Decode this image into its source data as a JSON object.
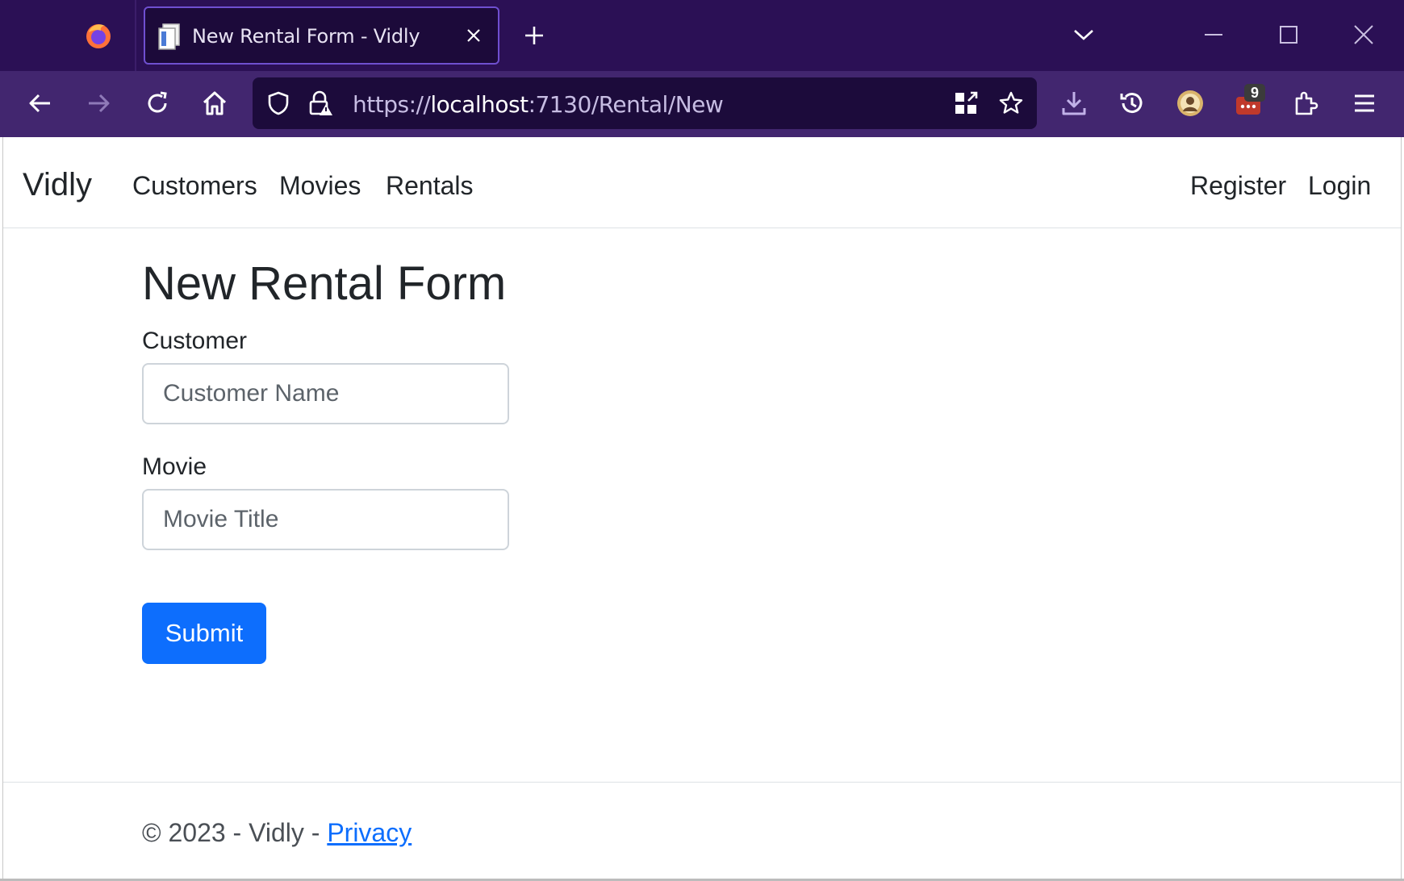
{
  "browser": {
    "tab_title": "New Rental Form - Vidly",
    "url_prefix": "https://",
    "url_host": "localhost",
    "url_rest": ":7130/Rental/New",
    "extension_badge": "9",
    "accent_color": "#2b1055",
    "icons": [
      "firefox-logo",
      "page-icon",
      "close-icon",
      "plus-icon",
      "chevron-down-icon",
      "minimize-icon",
      "maximize-icon",
      "close-window-icon",
      "back-icon",
      "forward-icon",
      "reload-icon",
      "home-icon",
      "shield-icon",
      "lock-warning-icon",
      "qr-icon",
      "star-icon",
      "download-icon",
      "history-icon",
      "avatar-icon",
      "extension-icon",
      "puzzle-icon",
      "menu-icon"
    ]
  },
  "site": {
    "brand": "Vidly",
    "nav": {
      "customers": "Customers",
      "movies": "Movies",
      "rentals": "Rentals",
      "register": "Register",
      "login": "Login"
    }
  },
  "form": {
    "title": "New Rental Form",
    "customer_label": "Customer",
    "customer_placeholder": "Customer Name",
    "movie_label": "Movie",
    "movie_placeholder": "Movie Title",
    "submit_label": "Submit",
    "primary_color": "#0d6efd"
  },
  "footer": {
    "text": "© 2023 - Vidly - ",
    "privacy_link": "Privacy"
  }
}
